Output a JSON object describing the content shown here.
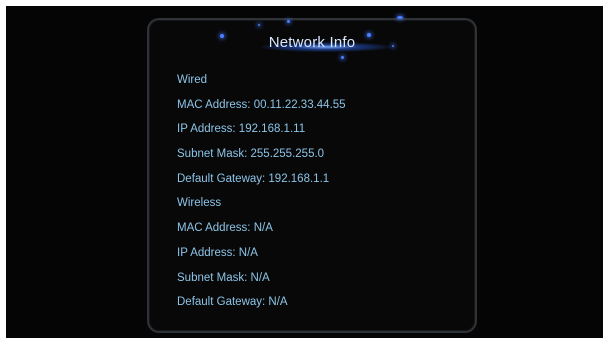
{
  "panel": {
    "title": "Network Info"
  },
  "wired": {
    "heading": "Wired",
    "mac_address": "MAC Address: 00.11.22.33.44.55",
    "ip_address": "IP Address: 192.168.1.11",
    "subnet_mask": "Subnet Mask: 255.255.255.0",
    "default_gateway": "Default Gateway: 192.168.1.1"
  },
  "wireless": {
    "heading": "Wireless",
    "mac_address": "MAC Address: N/A",
    "ip_address": "IP Address: N/A",
    "subnet_mask": "Subnet Mask: N/A",
    "default_gateway": "Default Gateway: N/A"
  },
  "colors": {
    "background": "#050505",
    "title_text": "#d8e8ff",
    "info_text": "#8cc4e8",
    "accent_glow": "#4a7dff"
  }
}
